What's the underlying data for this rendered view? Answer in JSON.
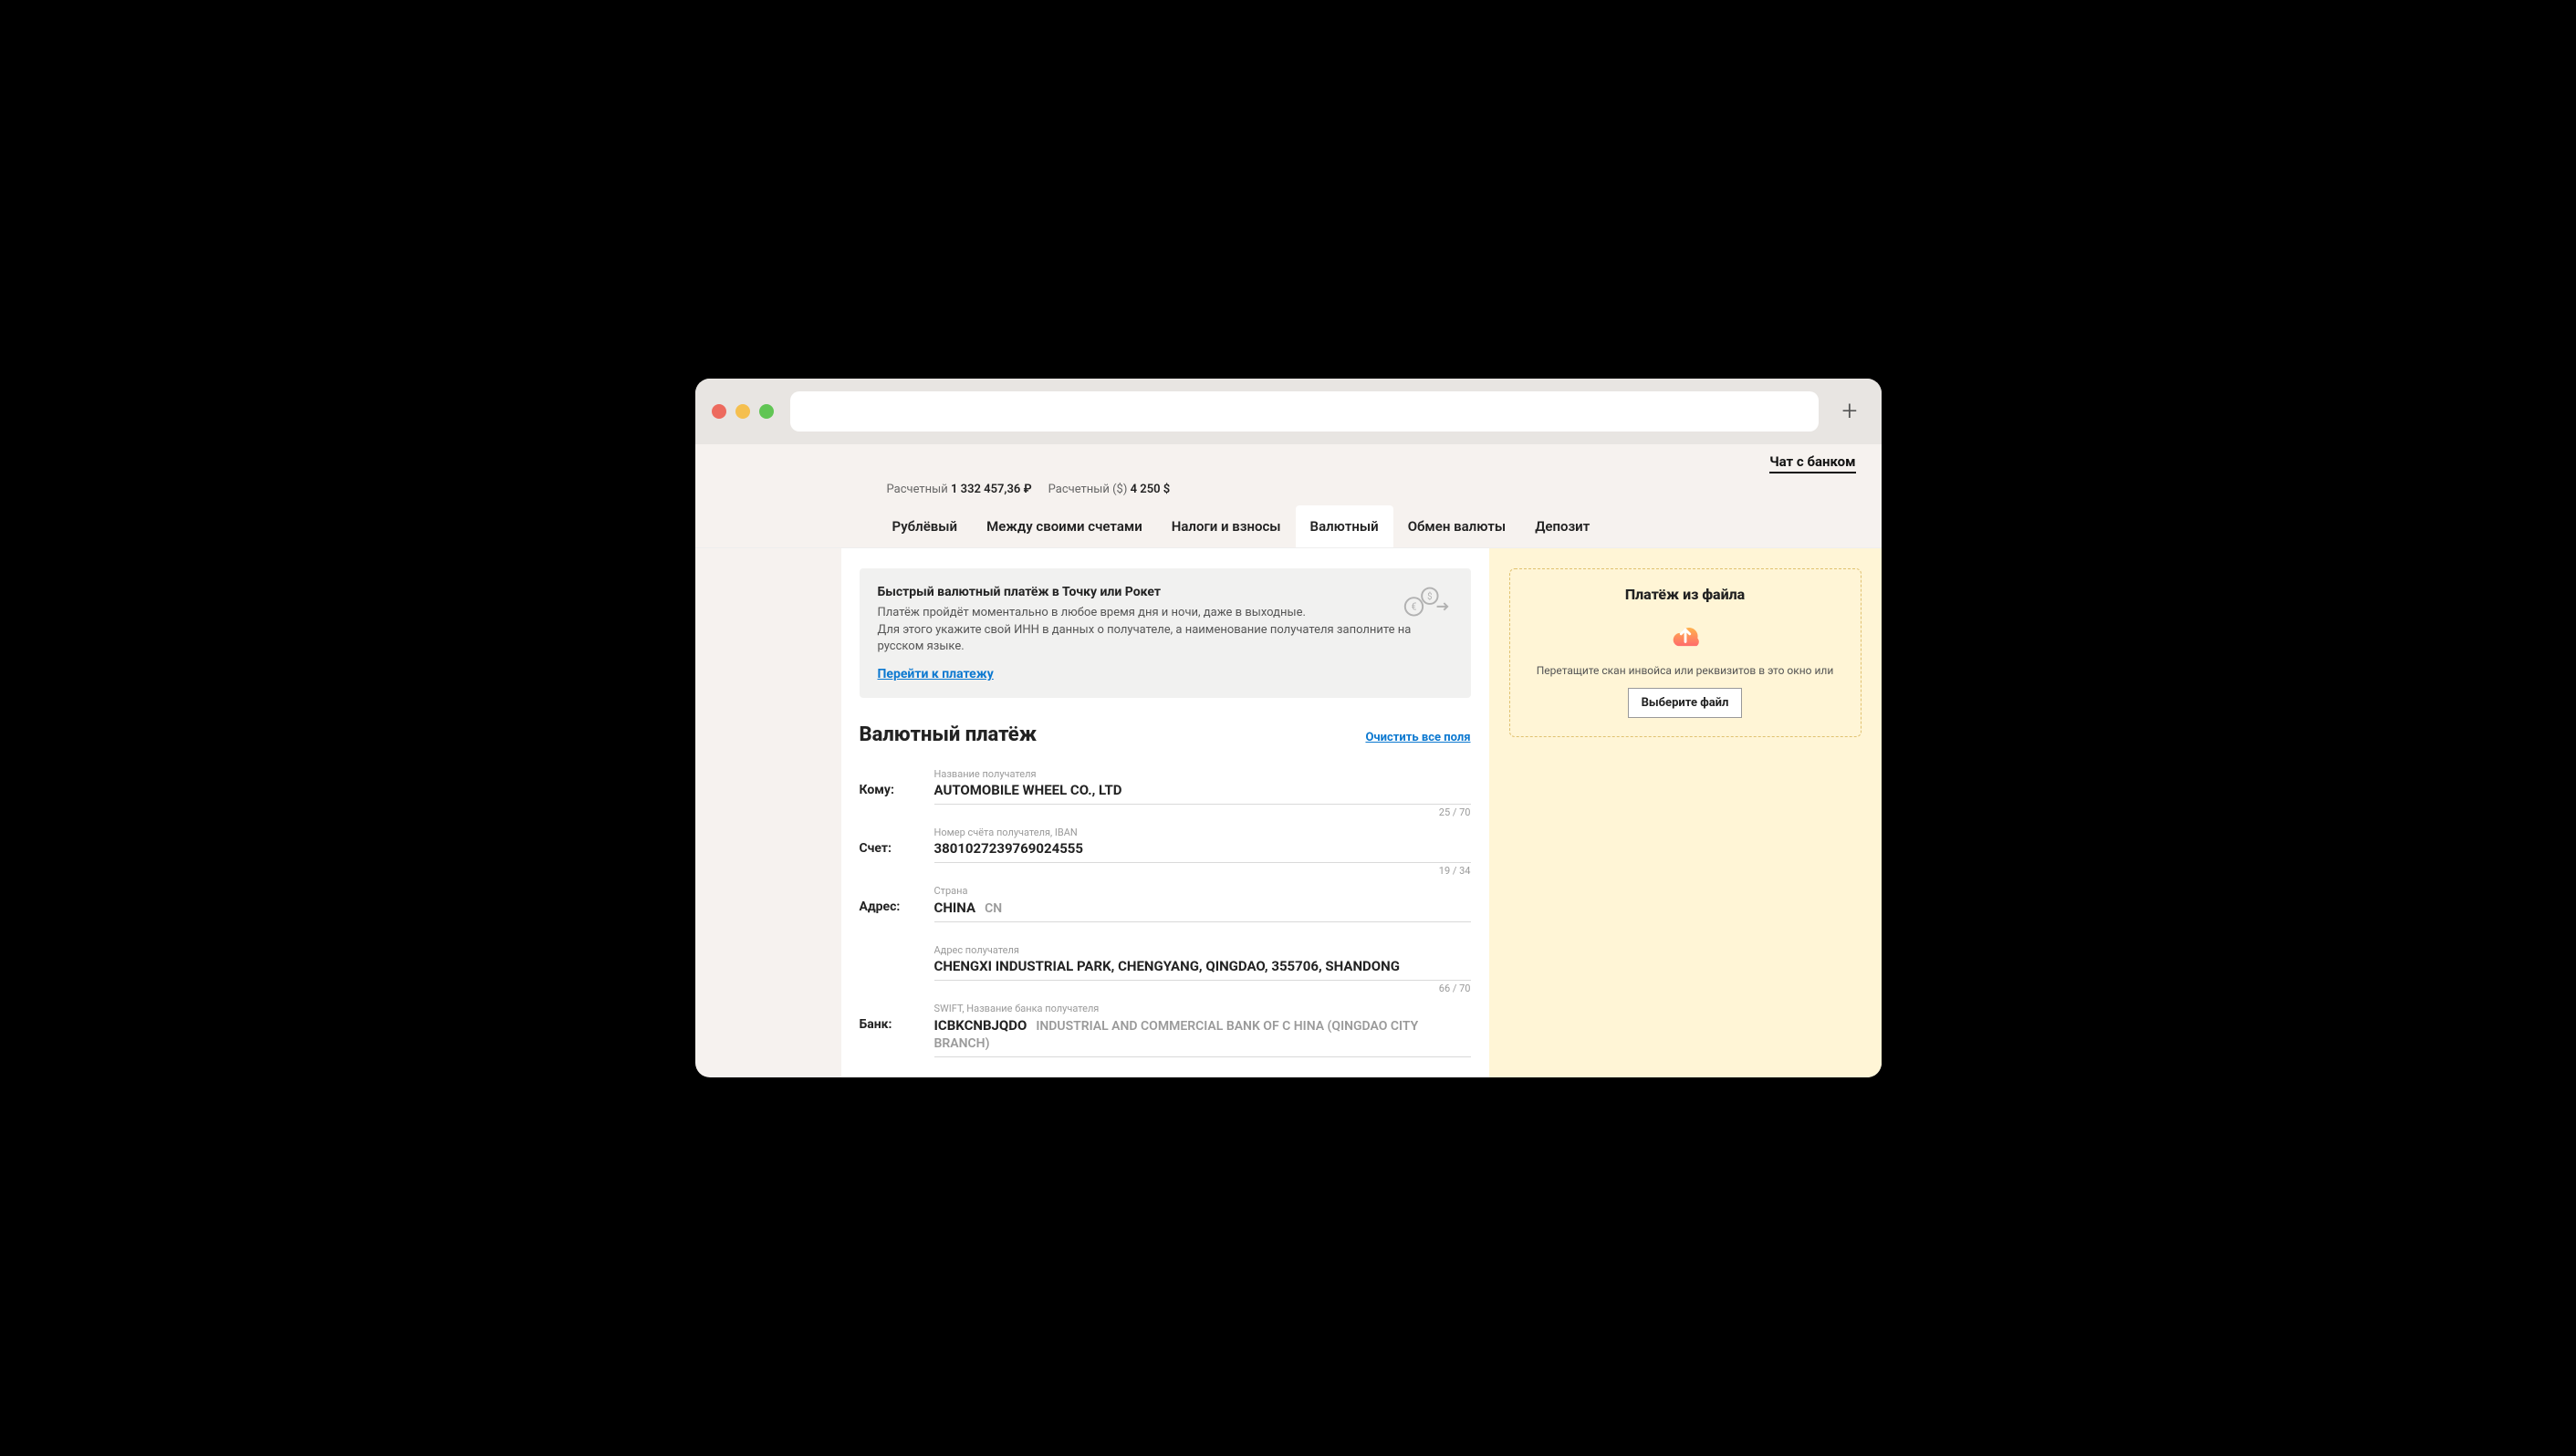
{
  "header": {
    "chat_link": "Чат с банком"
  },
  "accounts": [
    {
      "label": "Расчетный",
      "value": "1 332 457,36 ₽"
    },
    {
      "label": "Расчетный ($)",
      "value": "4 250 $"
    }
  ],
  "tabs": [
    {
      "label": "Рублёвый",
      "active": false
    },
    {
      "label": "Между своими счетами",
      "active": false
    },
    {
      "label": "Налоги и взносы",
      "active": false
    },
    {
      "label": "Валютный",
      "active": true
    },
    {
      "label": "Обмен валюты",
      "active": false
    },
    {
      "label": "Депозит",
      "active": false
    }
  ],
  "banner": {
    "title": "Быстрый валютный платёж в Точку или Рокет",
    "line1": "Платёж пройдёт моментально в любое время дня и ночи, даже в выходные.",
    "line2": "Для этого укажите свой ИНН в данных о получателе, а наименование получателя заполните на русском языке.",
    "link": "Перейти к платежу"
  },
  "form": {
    "heading": "Валютный платёж",
    "clear": "Очистить все поля",
    "rows": {
      "recipient": {
        "label": "Кому:",
        "hint": "Название получателя",
        "value": "AUTOMOBILE WHEEL CO., LTD",
        "count": "25 / 70"
      },
      "account": {
        "label": "Счет:",
        "hint": "Номер счёта получателя, IBAN",
        "value": "3801027239769024555",
        "count": "19 / 34"
      },
      "country": {
        "label": "Адрес:",
        "hint": "Страна",
        "value": "CHINA",
        "suffix": "CN"
      },
      "address": {
        "hint": "Адрес получателя",
        "value": "CHENGXI INDUSTRIAL PARK, CHENGYANG, QINGDAO, 355706, SHANDONG",
        "count": "66 / 70"
      },
      "bank": {
        "label": "Банк:",
        "hint": "SWIFT, Название банка получателя",
        "value": "ICBKCNBJQDO",
        "suffix": "INDUSTRIAL AND COMMERCIAL BANK OF C HINA (QINGDAO CITY BRANCH)"
      }
    }
  },
  "upload": {
    "title": "Платёж из файла",
    "text": "Перетащите скан инвойса или реквизитов в это окно или",
    "button": "Выберите файл"
  }
}
